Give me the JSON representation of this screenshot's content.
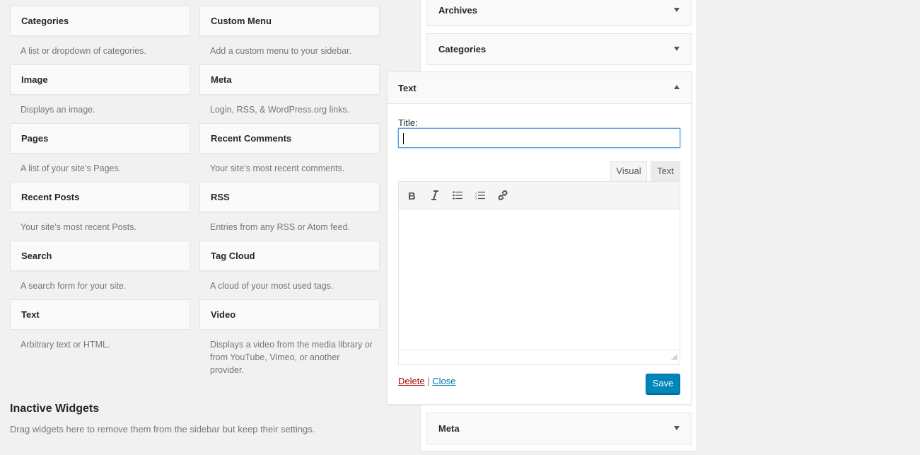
{
  "available_widgets": [
    {
      "title": "Categories",
      "description": "A list or dropdown of categories."
    },
    {
      "title": "Custom Menu",
      "description": "Add a custom menu to your sidebar."
    },
    {
      "title": "Image",
      "description": "Displays an image."
    },
    {
      "title": "Meta",
      "description": "Login, RSS, & WordPress.org links."
    },
    {
      "title": "Pages",
      "description": "A list of your site’s Pages."
    },
    {
      "title": "Recent Comments",
      "description": "Your site’s most recent comments."
    },
    {
      "title": "Recent Posts",
      "description": "Your site’s most recent Posts."
    },
    {
      "title": "RSS",
      "description": "Entries from any RSS or Atom feed."
    },
    {
      "title": "Search",
      "description": "A search form for your site."
    },
    {
      "title": "Tag Cloud",
      "description": "A cloud of your most used tags."
    },
    {
      "title": "Text",
      "description": "Arbitrary text or HTML."
    },
    {
      "title": "Video",
      "description": "Displays a video from the media library or from YouTube, Vimeo, or another provider."
    }
  ],
  "inactive": {
    "title": "Inactive Widgets",
    "description": "Drag widgets here to remove them from the sidebar but keep their settings."
  },
  "sidebar": {
    "widgets": [
      {
        "title": "Archives"
      },
      {
        "title": "Categories"
      },
      {
        "title": "Meta"
      }
    ],
    "open_widget": {
      "title": "Text",
      "title_label": "Title:",
      "title_value": "",
      "tabs": [
        "Visual",
        "Text"
      ],
      "active_tab": "Visual",
      "toolbar": [
        "bold-icon",
        "italic-icon",
        "bullet-list-icon",
        "numbered-list-icon",
        "link-icon"
      ],
      "delete_label": "Delete",
      "separator": "|",
      "close_label": "Close",
      "save_label": "Save"
    }
  },
  "colors": {
    "primary_button": "#0085ba",
    "delete_link": "#aa0000",
    "close_link": "#0073aa",
    "focus_border": "#5b9dd9"
  }
}
